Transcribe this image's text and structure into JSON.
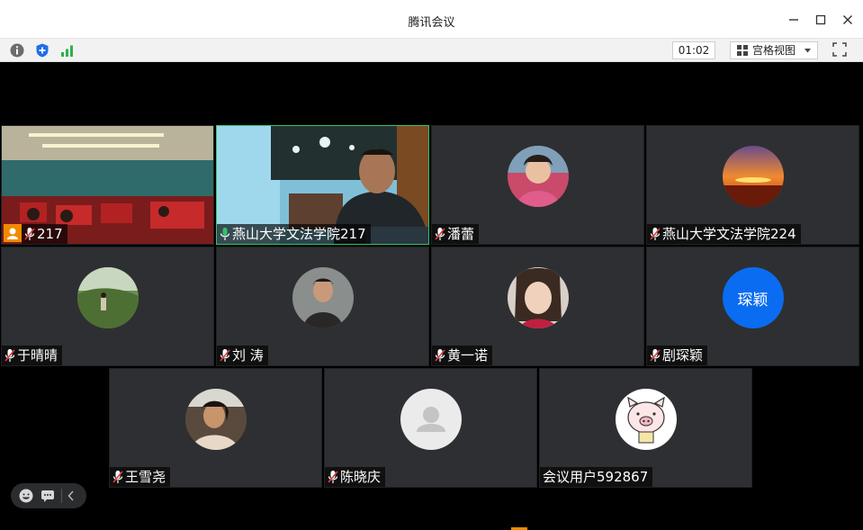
{
  "window": {
    "title": "腾讯会议"
  },
  "toolbar": {
    "timer": "01:02",
    "view_label": "宫格视图"
  },
  "participants": [
    {
      "name": "217",
      "mic": "muted",
      "video": true,
      "host_badge": true
    },
    {
      "name": "燕山大学文法学院217",
      "mic": "active",
      "video": true,
      "speaking": true
    },
    {
      "name": "潘蕾",
      "mic": "muted",
      "avatar": "photo"
    },
    {
      "name": "燕山大学文法学院224",
      "mic": "muted",
      "avatar": "sunset-photo"
    },
    {
      "name": "于晴晴",
      "mic": "muted",
      "avatar": "photo"
    },
    {
      "name": "刘 涛",
      "mic": "muted",
      "avatar": "photo"
    },
    {
      "name": "黄一诺",
      "mic": "muted",
      "avatar": "photo"
    },
    {
      "name": "剧琛颖",
      "mic": "muted",
      "avatar_text": "琛颖",
      "avatar_color": "#0a6cf0"
    },
    {
      "name": "王雪尧",
      "mic": "muted",
      "avatar": "photo"
    },
    {
      "name": "陈晓庆",
      "mic": "muted",
      "avatar": "default-user-icon"
    },
    {
      "name": "会议用户592867",
      "mic": "none",
      "avatar": "pig-cartoon"
    }
  ],
  "colors": {
    "accent_green": "#33c16b",
    "accent_blue": "#0a6cf0",
    "muted_red": "#e23b3b",
    "tile_bg": "#2e2f32"
  }
}
